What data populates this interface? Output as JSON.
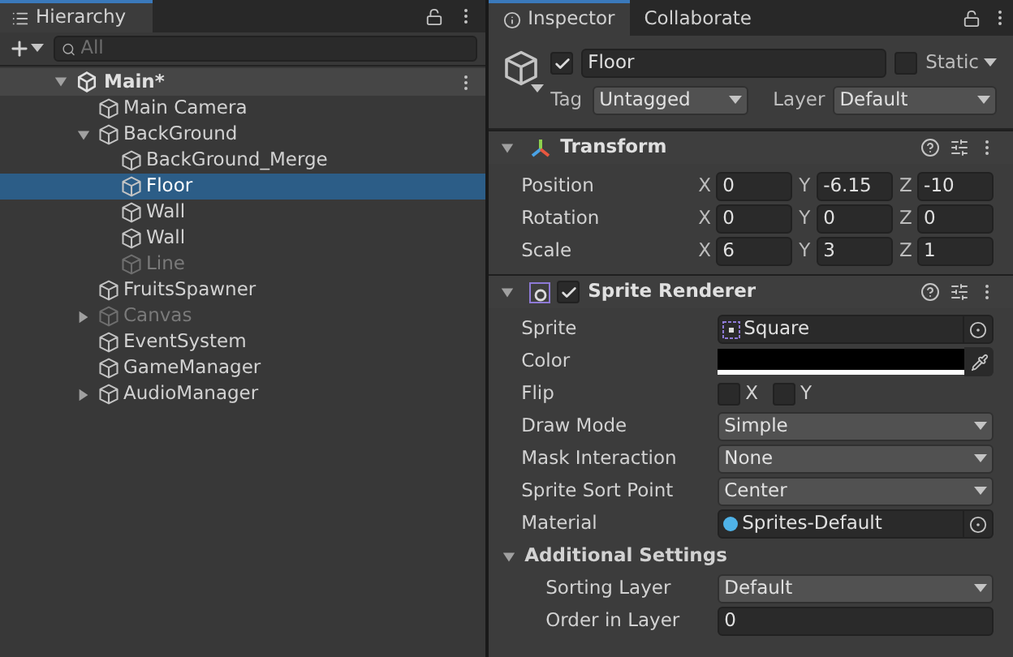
{
  "hierarchy": {
    "tab": {
      "title": "Hierarchy",
      "selected": true
    },
    "search": {
      "placeholder": "All"
    },
    "scene": {
      "name": "Main*",
      "expanded": true,
      "children": [
        {
          "name": "Main Camera",
          "selected": false,
          "active": true
        },
        {
          "name": "BackGround",
          "selected": false,
          "active": true,
          "expanded": true,
          "children": [
            {
              "name": "BackGround_Merge",
              "selected": false,
              "active": true
            },
            {
              "name": "Floor",
              "selected": true,
              "active": true
            },
            {
              "name": "Wall",
              "selected": false,
              "active": true
            },
            {
              "name": "Wall",
              "selected": false,
              "active": true
            },
            {
              "name": "Line",
              "selected": false,
              "active": false
            }
          ]
        },
        {
          "name": "FruitsSpawner",
          "selected": false,
          "active": true
        },
        {
          "name": "Canvas",
          "selected": false,
          "active": false,
          "expanded": false
        },
        {
          "name": "EventSystem",
          "selected": false,
          "active": true
        },
        {
          "name": "GameManager",
          "selected": false,
          "active": true
        },
        {
          "name": "AudioManager",
          "selected": false,
          "active": true,
          "expanded": false
        }
      ]
    }
  },
  "inspector": {
    "tabs": [
      {
        "label": "Inspector",
        "selected": true
      },
      {
        "label": "Collaborate",
        "selected": false
      }
    ],
    "object": {
      "active": true,
      "name": "Floor",
      "static": false,
      "static_label": "Static",
      "tag_label": "Tag",
      "tag": "Untagged",
      "layer_label": "Layer",
      "layer": "Default"
    },
    "transform": {
      "title": "Transform",
      "expanded": true,
      "rows": [
        {
          "label": "Position",
          "axes": [
            "X",
            "Y",
            "Z"
          ],
          "values": [
            "0",
            "-6.15",
            "-10"
          ]
        },
        {
          "label": "Rotation",
          "axes": [
            "X",
            "Y",
            "Z"
          ],
          "values": [
            "0",
            "0",
            "0"
          ]
        },
        {
          "label": "Scale",
          "axes": [
            "X",
            "Y",
            "Z"
          ],
          "values": [
            "6",
            "3",
            "1"
          ]
        }
      ]
    },
    "sprite_renderer": {
      "title": "Sprite Renderer",
      "expanded": true,
      "enabled": true,
      "properties": [
        {
          "kind": "sprite_object",
          "label": "Sprite",
          "value": "Square"
        },
        {
          "kind": "color",
          "label": "Color",
          "color": "#000000"
        },
        {
          "kind": "flip",
          "label": "Flip",
          "x_label": "X",
          "x_checked": false,
          "y_label": "Y",
          "y_checked": false
        },
        {
          "kind": "dropdown",
          "label": "Draw Mode",
          "value": "Simple"
        },
        {
          "kind": "dropdown",
          "label": "Mask Interaction",
          "value": "None"
        },
        {
          "kind": "dropdown",
          "label": "Sprite Sort Point",
          "value": "Center"
        },
        {
          "kind": "material_object",
          "label": "Material",
          "value": "Sprites-Default"
        }
      ],
      "additional": {
        "title": "Additional Settings",
        "expanded": true,
        "properties": [
          {
            "kind": "dropdown",
            "label": "Sorting Layer",
            "value": "Default"
          },
          {
            "kind": "number",
            "label": "Order in Layer",
            "value": "0"
          }
        ]
      }
    }
  }
}
